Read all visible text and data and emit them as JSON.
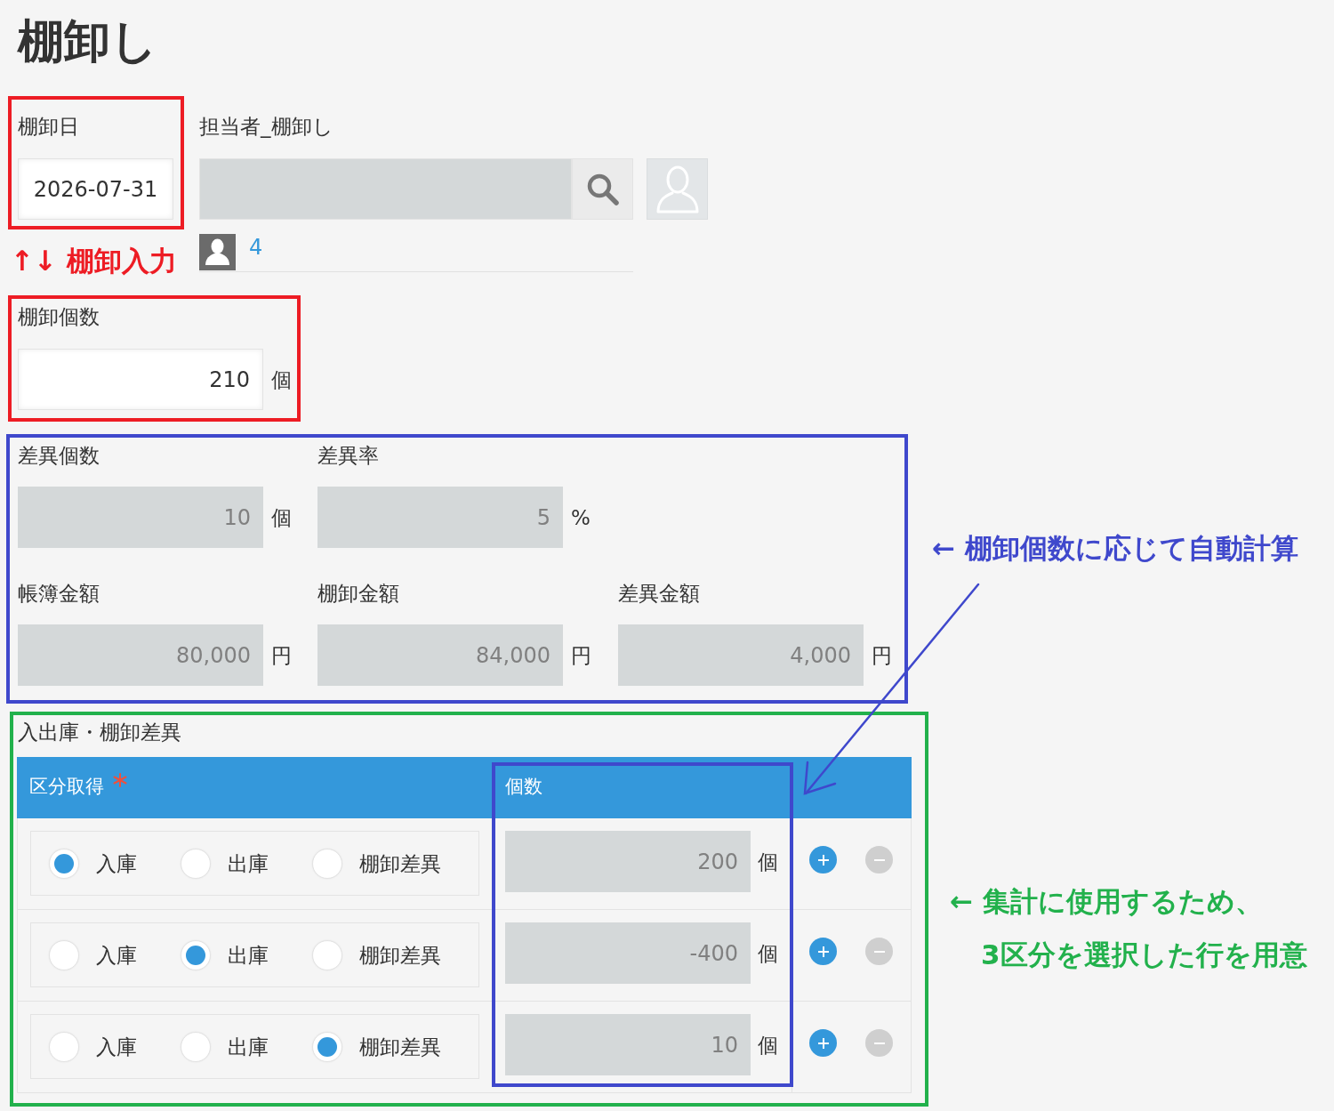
{
  "title": "棚卸し",
  "date_field": {
    "label": "棚卸日",
    "value": "2026-07-31"
  },
  "user_field": {
    "label": "担当者_棚卸し",
    "users": [
      {
        "name": "4"
      }
    ]
  },
  "count_field": {
    "label": "棚卸個数",
    "value": "210",
    "unit": "個"
  },
  "calculated_rows": [
    {
      "fields": [
        {
          "label": "差異個数",
          "value": "10",
          "unit": "個"
        },
        {
          "label": "差異率",
          "value": "5",
          "unit": "%"
        }
      ]
    },
    {
      "fields": [
        {
          "label": "帳簿金額",
          "value": "80,000",
          "unit": "円"
        },
        {
          "label": "棚卸金額",
          "value": "84,000",
          "unit": "円"
        },
        {
          "label": "差異金額",
          "value": "4,000",
          "unit": "円"
        }
      ]
    }
  ],
  "table": {
    "label": "入出庫・棚卸差異",
    "columns": [
      {
        "label": "区分取得",
        "required": true
      },
      {
        "label": "個数",
        "required": false
      }
    ],
    "rows": [
      {
        "options": [
          {
            "label": "入庫",
            "selected": true
          },
          {
            "label": "出庫",
            "selected": false
          },
          {
            "label": "棚卸差異",
            "selected": false
          }
        ],
        "quantity": "200",
        "unit": "個"
      },
      {
        "options": [
          {
            "label": "入庫",
            "selected": false
          },
          {
            "label": "出庫",
            "selected": true
          },
          {
            "label": "棚卸差異",
            "selected": false
          }
        ],
        "quantity": "-400",
        "unit": "個"
      },
      {
        "options": [
          {
            "label": "入庫",
            "selected": false
          },
          {
            "label": "出庫",
            "selected": false
          },
          {
            "label": "棚卸差異",
            "selected": true
          }
        ],
        "quantity": "10",
        "unit": "個"
      }
    ]
  },
  "annotations": [
    {
      "lines": [
        "↑↓ 棚卸入力"
      ],
      "color": "#ed1c24"
    },
    {
      "lines": [
        "← 棚卸個数に応じて自動計算"
      ],
      "color": "#3f48cc"
    },
    {
      "lines": [
        "← 集計に使用するため、",
        "3区分を選択した行を用意"
      ],
      "color": "#22b14c"
    }
  ]
}
